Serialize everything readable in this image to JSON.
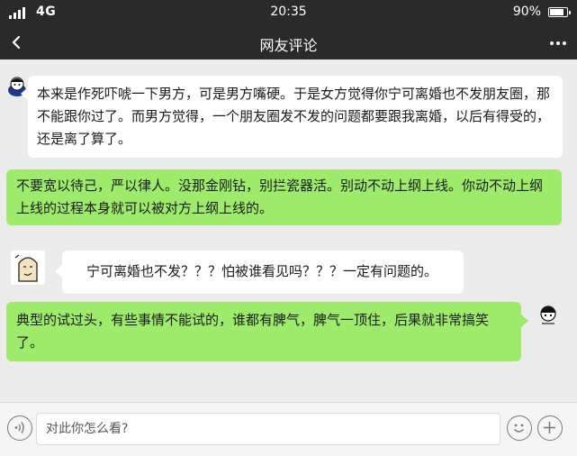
{
  "status_bar": {
    "network": "4G",
    "time": "20:35",
    "battery": "90%",
    "battery_level": 0.9,
    "signal_icon": "signal-bars-icon",
    "battery_icon": "battery-icon"
  },
  "nav": {
    "title": "网友评论",
    "back_icon": "chevron-left-icon",
    "more_icon": "more-dots-icon"
  },
  "messages": [
    {
      "side": "left",
      "bubble_color": "#ffffff",
      "avatar_icon": "cartoon-avatar-icon",
      "text": "本来是作死吓唬一下男方，可是男方嘴硬。于是女方觉得你宁可离婚也不发朋友圈，那不能跟你过了。而男方觉得，一个朋友圈发不发的问题都要跟我离婚，以后有得受的，还是离了算了。"
    },
    {
      "side": "right",
      "bubble_color": "#9eea6a",
      "text": "不要宽以待己，严以律人。没那金刚钻，别拦瓷器活。别动不动上纲上线。你动不动上纲上线的过程本身就可以被对方上纲上线的。"
    },
    {
      "side": "left",
      "bubble_color": "#ffffff",
      "avatar_icon": "cartoon-avatar-icon",
      "text": "宁可离婚也不发？？？怕被谁看见吗？？？一定有问题的。"
    },
    {
      "side": "right",
      "bubble_color": "#9eea6a",
      "avatar_icon": "cartoon-avatar-icon",
      "text": "典型的试过头，有些事情不能试的，谁都有脾气，脾气一顶住，后果就非常搞笑了。"
    }
  ],
  "input_bar": {
    "placeholder": "对此你怎么看?",
    "voice_icon": "voice-icon",
    "emoji_icon": "emoji-icon",
    "add_icon": "plus-icon"
  },
  "colors": {
    "header_bg": "#2a2a2a",
    "chat_bg": "#ebebeb",
    "green_bubble": "#9eea6a",
    "white_bubble": "#ffffff"
  }
}
